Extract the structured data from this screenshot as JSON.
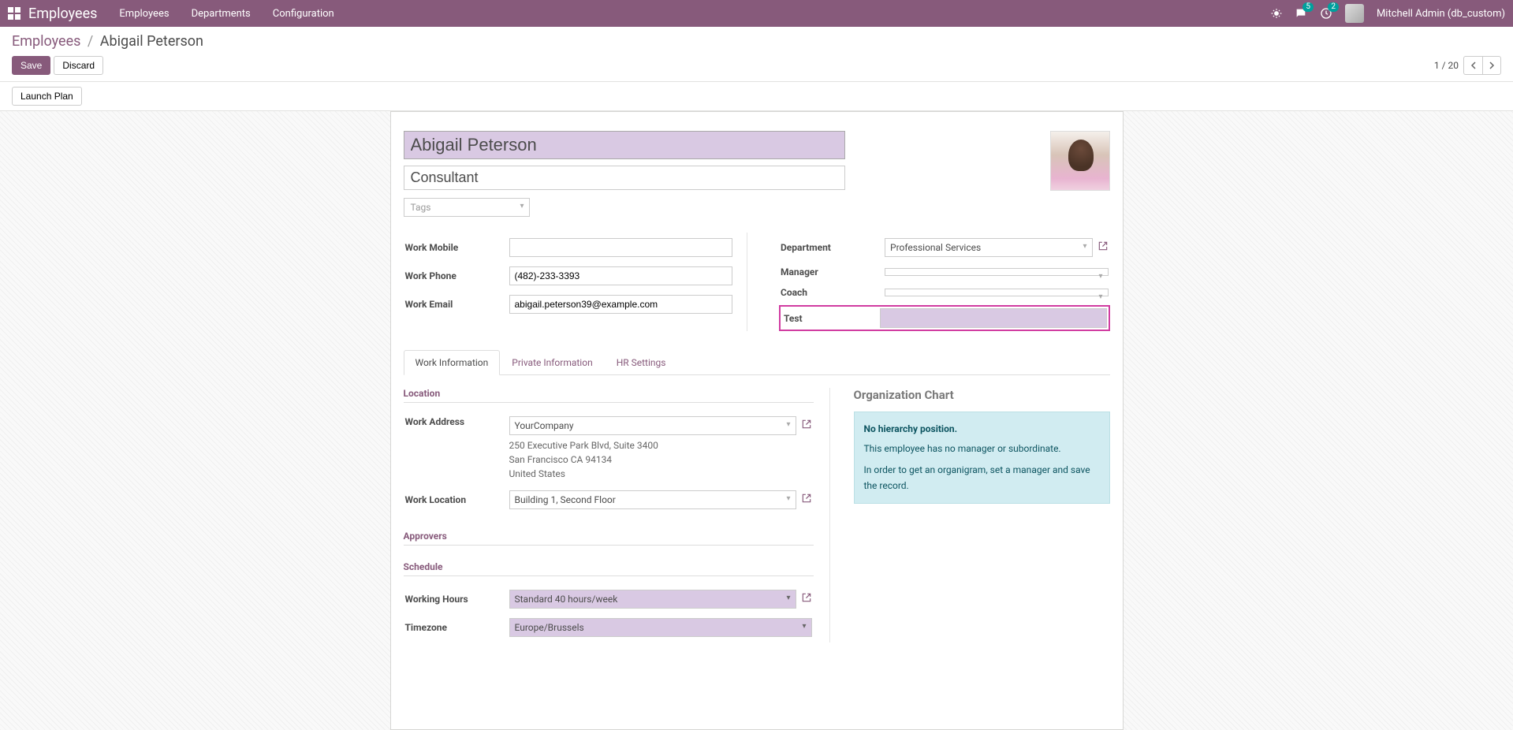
{
  "nav": {
    "app_title": "Employees",
    "links": [
      "Employees",
      "Departments",
      "Configuration"
    ],
    "msg_count": "5",
    "activity_count": "2",
    "user_name": "Mitchell Admin (db_custom)"
  },
  "breadcrumb": {
    "root": "Employees",
    "current": "Abigail Peterson"
  },
  "actions": {
    "save": "Save",
    "discard": "Discard",
    "launch_plan": "Launch Plan"
  },
  "pager": {
    "value": "1 / 20"
  },
  "form": {
    "name": "Abigail Peterson",
    "job_title": "Consultant",
    "tags_placeholder": "Tags",
    "left": {
      "work_mobile": {
        "label": "Work Mobile",
        "value": ""
      },
      "work_phone": {
        "label": "Work Phone",
        "value": "(482)-233-3393"
      },
      "work_email": {
        "label": "Work Email",
        "value": "abigail.peterson39@example.com"
      }
    },
    "right": {
      "department": {
        "label": "Department",
        "value": "Professional Services"
      },
      "manager": {
        "label": "Manager",
        "value": ""
      },
      "coach": {
        "label": "Coach",
        "value": ""
      },
      "test": {
        "label": "Test",
        "value": ""
      }
    }
  },
  "tabs": {
    "items": [
      "Work Information",
      "Private Information",
      "HR Settings"
    ],
    "active": 0
  },
  "work_info": {
    "location": {
      "title": "Location",
      "work_address": {
        "label": "Work Address",
        "value": "YourCompany"
      },
      "addr_lines": [
        "250 Executive Park Blvd, Suite 3400",
        "San Francisco CA 94134",
        "United States"
      ],
      "work_location": {
        "label": "Work Location",
        "value": "Building 1, Second Floor"
      }
    },
    "approvers": {
      "title": "Approvers"
    },
    "schedule": {
      "title": "Schedule",
      "working_hours": {
        "label": "Working Hours",
        "value": "Standard 40 hours/week"
      },
      "timezone": {
        "label": "Timezone",
        "value": "Europe/Brussels"
      }
    }
  },
  "org_chart": {
    "title": "Organization Chart",
    "alert_title": "No hierarchy position.",
    "line1": "This employee has no manager or subordinate.",
    "line2": "In order to get an organigram, set a manager and save the record."
  }
}
